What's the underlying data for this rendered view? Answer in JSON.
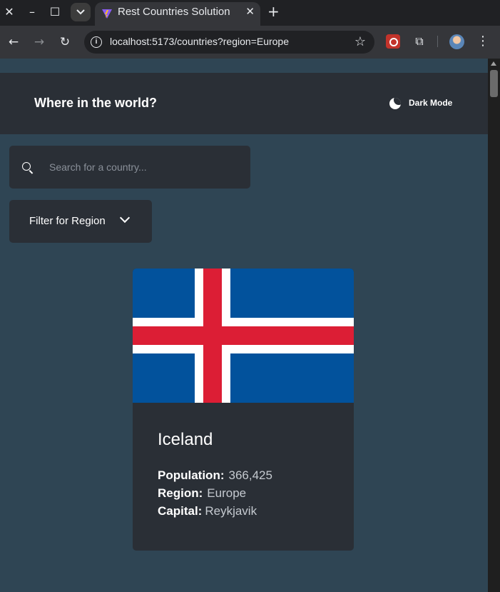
{
  "browser": {
    "tab_title": "Rest Countries Solution",
    "url": "localhost:5173/countries?region=Europe"
  },
  "header": {
    "title": "Where in the world?",
    "dark_mode_label": "Dark Mode"
  },
  "search": {
    "placeholder": "Search for a country..."
  },
  "filter": {
    "label": "Filter for Region"
  },
  "countries": [
    {
      "name": "Iceland",
      "population_label": "Population:",
      "population": "366,425",
      "region_label": "Region:",
      "region": "Europe",
      "capital_label": "Capital:",
      "capital": "Reykjavik"
    }
  ],
  "colors": {
    "background": "#2f4554",
    "element": "#2a2f36",
    "flag_blue": "#02529c",
    "flag_red": "#dc1e35"
  }
}
